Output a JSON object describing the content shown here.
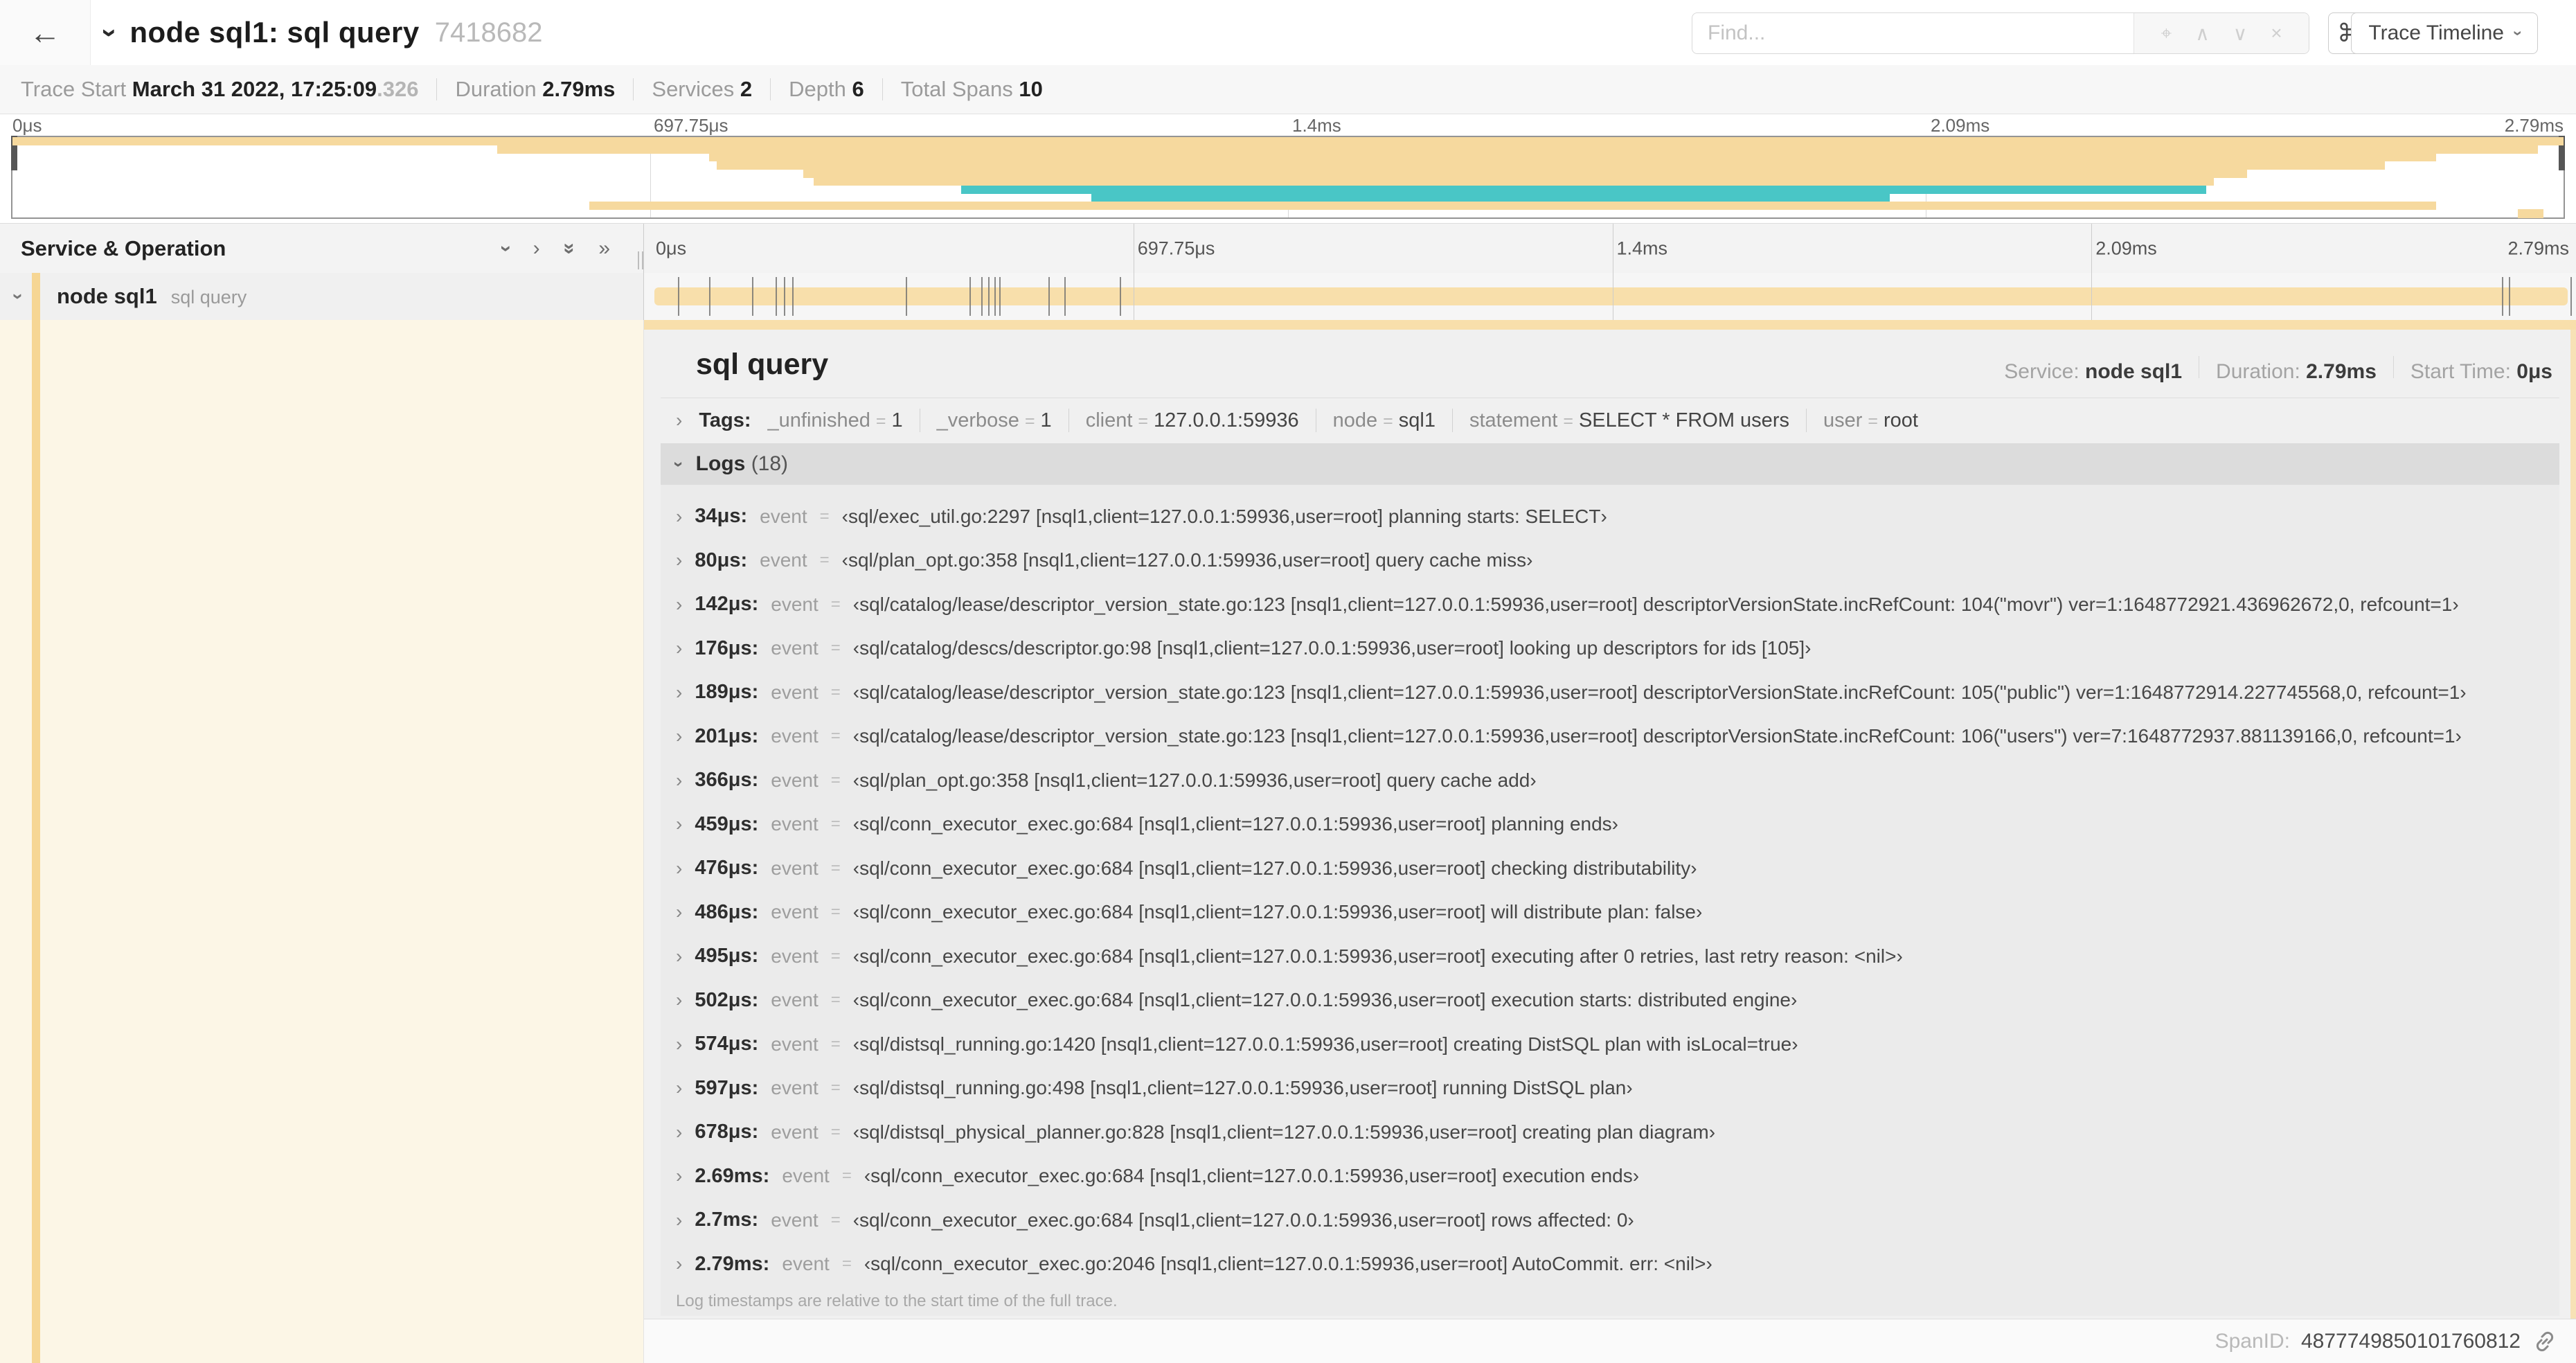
{
  "colors": {
    "tan": "#f6d99e",
    "teal": "#49c6c6",
    "tan_bar": "#f8dfab",
    "cream_column": "#fcf6e6",
    "color_stripe": "#f6d694"
  },
  "header": {
    "back_icon": "←",
    "title": "node sql1: sql query",
    "trace_id": "7418682",
    "find_placeholder": "Find...",
    "keyboard_shortcut_icon": "⌘",
    "view_selector_label": "Trace Timeline"
  },
  "summary": {
    "trace_start_label": "Trace Start",
    "trace_start_value": "March 31 2022, 17:25:09",
    "trace_start_fraction": ".326",
    "duration_label": "Duration",
    "duration_value": "2.79ms",
    "services_label": "Services",
    "services_value": "2",
    "depth_label": "Depth",
    "depth_value": "6",
    "total_spans_label": "Total Spans",
    "total_spans_value": "10"
  },
  "minimap": {
    "ticks": [
      {
        "label": "0μs",
        "pct": 0
      },
      {
        "label": "697.75μs",
        "pct": 0.25
      },
      {
        "label": "1.4ms",
        "pct": 0.5
      },
      {
        "label": "2.09ms",
        "pct": 0.75
      },
      {
        "label": "2.79ms",
        "pct": 1
      }
    ],
    "spans": [
      {
        "start": 0,
        "end": 100,
        "color": "tan"
      },
      {
        "start": 19,
        "end": 99,
        "color": "tan"
      },
      {
        "start": 27.3,
        "end": 95,
        "color": "tan"
      },
      {
        "start": 27.6,
        "end": 93,
        "color": "tan"
      },
      {
        "start": 31,
        "end": 87.6,
        "color": "tan"
      },
      {
        "start": 31.4,
        "end": 86.3,
        "color": "tan"
      },
      {
        "start": 37.2,
        "end": 86,
        "color": "teal"
      },
      {
        "start": 42.3,
        "end": 73.6,
        "color": "teal"
      },
      {
        "start": 22.6,
        "end": 95,
        "color": "tan"
      },
      {
        "start": 98.2,
        "end": 99.2,
        "color": "tan"
      }
    ]
  },
  "timeline": {
    "column_header": "Service & Operation",
    "ticks": [
      {
        "label": "0μs",
        "pct": 0
      },
      {
        "label": "697.75μs",
        "pct": 0.25
      },
      {
        "label": "1.4ms",
        "pct": 0.5
      },
      {
        "label": "2.09ms",
        "pct": 0.75
      },
      {
        "label": "2.79ms",
        "pct": 1
      }
    ]
  },
  "span_row": {
    "service": "node sql1",
    "operation": "sql query",
    "total_us": 2790,
    "log_marks_us": [
      34,
      80,
      142,
      176,
      189,
      201,
      366,
      459,
      476,
      486,
      495,
      502,
      574,
      597,
      678,
      2690,
      2700,
      2790
    ]
  },
  "detail": {
    "title": "sql query",
    "service_label": "Service:",
    "service_value": "node sql1",
    "duration_label": "Duration:",
    "duration_value": "2.79ms",
    "start_label": "Start Time:",
    "start_value": "0μs",
    "tags_label": "Tags:",
    "tags": [
      {
        "key": "_unfinished",
        "value": "1"
      },
      {
        "key": "_verbose",
        "value": "1"
      },
      {
        "key": "client",
        "value": "127.0.0.1:59936"
      },
      {
        "key": "node",
        "value": "sql1"
      },
      {
        "key": "statement",
        "value": "SELECT * FROM users"
      },
      {
        "key": "user",
        "value": "root"
      }
    ],
    "logs_label": "Logs",
    "logs_count": "(18)",
    "logs_field_label": "event",
    "logs": [
      {
        "time": "34μs:",
        "value": "‹sql/exec_util.go:2297 [nsql1,client=127.0.0.1:59936,user=root] planning starts: SELECT›"
      },
      {
        "time": "80μs:",
        "value": "‹sql/plan_opt.go:358 [nsql1,client=127.0.0.1:59936,user=root] query cache miss›"
      },
      {
        "time": "142μs:",
        "value": "‹sql/catalog/lease/descriptor_version_state.go:123 [nsql1,client=127.0.0.1:59936,user=root] descriptorVersionState.incRefCount: 104(\"movr\") ver=1:1648772921.436962672,0, refcount=1›"
      },
      {
        "time": "176μs:",
        "value": "‹sql/catalog/descs/descriptor.go:98 [nsql1,client=127.0.0.1:59936,user=root] looking up descriptors for ids [105]›"
      },
      {
        "time": "189μs:",
        "value": "‹sql/catalog/lease/descriptor_version_state.go:123 [nsql1,client=127.0.0.1:59936,user=root] descriptorVersionState.incRefCount: 105(\"public\") ver=1:1648772914.227745568,0, refcount=1›"
      },
      {
        "time": "201μs:",
        "value": "‹sql/catalog/lease/descriptor_version_state.go:123 [nsql1,client=127.0.0.1:59936,user=root] descriptorVersionState.incRefCount: 106(\"users\") ver=7:1648772937.881139166,0, refcount=1›"
      },
      {
        "time": "366μs:",
        "value": "‹sql/plan_opt.go:358 [nsql1,client=127.0.0.1:59936,user=root] query cache add›"
      },
      {
        "time": "459μs:",
        "value": "‹sql/conn_executor_exec.go:684 [nsql1,client=127.0.0.1:59936,user=root] planning ends›"
      },
      {
        "time": "476μs:",
        "value": "‹sql/conn_executor_exec.go:684 [nsql1,client=127.0.0.1:59936,user=root] checking distributability›"
      },
      {
        "time": "486μs:",
        "value": "‹sql/conn_executor_exec.go:684 [nsql1,client=127.0.0.1:59936,user=root] will distribute plan: false›"
      },
      {
        "time": "495μs:",
        "value": "‹sql/conn_executor_exec.go:684 [nsql1,client=127.0.0.1:59936,user=root] executing after 0 retries, last retry reason: <nil>›"
      },
      {
        "time": "502μs:",
        "value": "‹sql/conn_executor_exec.go:684 [nsql1,client=127.0.0.1:59936,user=root] execution starts: distributed engine›"
      },
      {
        "time": "574μs:",
        "value": "‹sql/distsql_running.go:1420 [nsql1,client=127.0.0.1:59936,user=root] creating DistSQL plan with isLocal=true›"
      },
      {
        "time": "597μs:",
        "value": "‹sql/distsql_running.go:498 [nsql1,client=127.0.0.1:59936,user=root] running DistSQL plan›"
      },
      {
        "time": "678μs:",
        "value": "‹sql/distsql_physical_planner.go:828 [nsql1,client=127.0.0.1:59936,user=root] creating plan diagram›"
      },
      {
        "time": "2.69ms:",
        "value": "‹sql/conn_executor_exec.go:684 [nsql1,client=127.0.0.1:59936,user=root] execution ends›"
      },
      {
        "time": "2.7ms:",
        "value": "‹sql/conn_executor_exec.go:684 [nsql1,client=127.0.0.1:59936,user=root] rows affected: 0›"
      },
      {
        "time": "2.79ms:",
        "value": "‹sql/conn_executor_exec.go:2046 [nsql1,client=127.0.0.1:59936,user=root] AutoCommit. err: <nil>›"
      }
    ],
    "logs_note": "Log timestamps are relative to the start time of the full trace.",
    "spanid_label": "SpanID:",
    "spanid_value": "4877749850101760812"
  }
}
